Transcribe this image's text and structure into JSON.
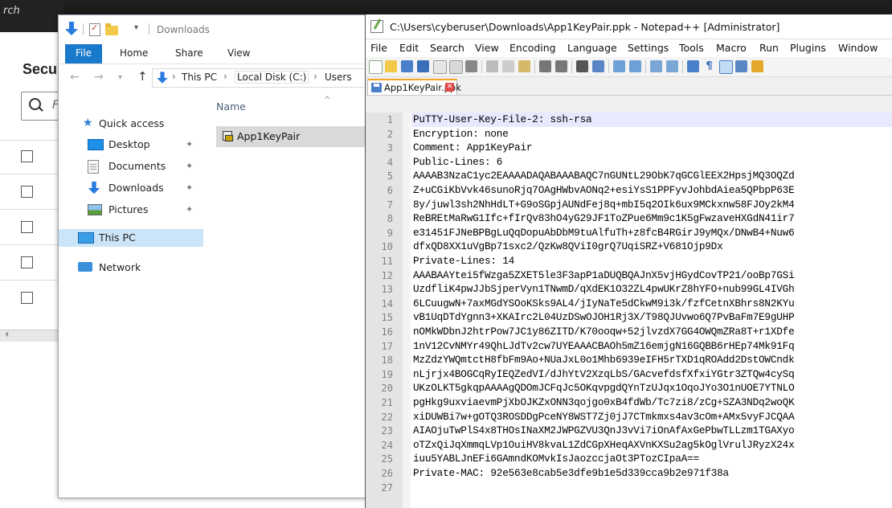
{
  "background_app": {
    "search_fragment": "rch",
    "heading_fragment": "Secu",
    "search_placeholder_fragment": "F"
  },
  "explorer": {
    "title": "Downloads",
    "ribbon_tabs": [
      "File",
      "Home",
      "Share",
      "View"
    ],
    "breadcrumb": [
      "This PC",
      "Local Disk (C:)",
      "Users"
    ],
    "nav": {
      "quick_access": "Quick access",
      "desktop": "Desktop",
      "documents": "Documents",
      "downloads": "Downloads",
      "pictures": "Pictures",
      "this_pc": "This PC",
      "network": "Network"
    },
    "column_name": "Name",
    "files": [
      "App1KeyPair"
    ]
  },
  "notepad": {
    "title": "C:\\Users\\cyberuser\\Downloads\\App1KeyPair.ppk - Notepad++ [Administrator]",
    "menu": [
      "File",
      "Edit",
      "Search",
      "View",
      "Encoding",
      "Language",
      "Settings",
      "Tools",
      "Macro",
      "Run",
      "Plugins",
      "Window"
    ],
    "tab_label": "App1KeyPair.ppk",
    "lines": [
      "PuTTY-User-Key-File-2: ssh-rsa",
      "Encryption: none",
      "Comment: App1KeyPair",
      "Public-Lines: 6",
      "AAAAB3NzaC1yc2EAAAADAQABAAABAQC7nGUNtL29ObK7qGCGlEEX2HpsjMQ3OQZd",
      "Z+uCGiKbVvk46sunoRjq7OAgHWbvAONq2+esiYsS1PPFyvJohbdAiea5QPbpP63E",
      "8y/juwl3sh2NhHdLT+G9oSGpjAUNdFej8q+mbI5q2OIk6ux9MCkxnw58FJOy2kM4",
      "ReBREtMaRwG1Ifc+fIrQv83hO4yG29JF1ToZPue6Mm9c1K5gFwzaveHXGdN41ir7",
      "e31451FJNeBPBgLuQqDopuAbDbM9tuAlfuTh+z8fcB4RGirJ9yMQx/DNwB4+Nuw6",
      "dfxQD8XX1uVgBp71sxc2/QzKw8QViI0grQ7UqiSRZ+V681Ojp9Dx",
      "Private-Lines: 14",
      "AAABAAYtei5fWzga5ZXET5le3F3apP1aDUQBQAJnX5vjHGydCovTP21/ooBp7GSi",
      "UzdfliK4pwJJbSjperVyn1TNwmD/qXdEK1O32ZL4pwUKrZ8hYFO+nub99GL4IVGh",
      "6LCuugwN+7axMGdYSOoKSks9AL4/jIyNaTe5dCkwM9i3k/fzfCetnXBhrs8N2KYu",
      "vB1UqDTdYgnn3+XKAIrc2L04UzDSwOJOH1Rj3X/T98QJUvwo6Q7PvBaFm7E9gUHP",
      "nOMkWDbnJ2htrPow7JC1y86ZITD/K70ooqw+52jlvzdX7GG4OWQmZRa8T+r1XDfe",
      "1nV12CvNMYr49QhLJdTv2cw7UYEAAACBAOh5mZ16emjgN16GQBB6rHEp74Mk91Fq",
      "MzZdzYWQmtctH8fbFm9Ao+NUaJxL0o1Mhb6939eIFH5rTXD1qROAdd2DstOWCndk",
      "nLjrjx4BOGCqRyIEQZedVI/dJhYtV2XzqLbS/GAcvefdsfXfxiYGtr3ZTQw4cySq",
      "UKzOLKT5gkqpAAAAgQDOmJCFqJc5OKqvpgdQYnTzUJqx1OqoJYo3O1nUOE7YTNLO",
      "pgHkg9uxviaevmPjXbOJKZxONN3qojgo0xB4fdWb/Tc7zi8/zCg+SZA3NDq2woQK",
      "xiDUWBi7w+gOTQ3ROSDDgPceNY8WST7Zj0jJ7CTmkmxs4av3cOm+AMx5vyFJCQAA",
      "AIAOjuTwPlS4x8THOsINaXM2JWPGZVU3QnJ3vVi7iOnAfAxGePbwTLLzm1TGAXyo",
      "oTZxQiJqXmmqLVp1OuiHV8kvaL1ZdCGpXHeqAXVnKXSu2ag5kOglVrulJRyzX24x",
      "iuu5YABLJnEFi6GAmndKOMvkIsJaozccjaOt3PTozCIpaA==",
      "Private-MAC: 92e563e8cab5e3dfe9b1e5d339cca9b2e971f38a",
      ""
    ]
  }
}
